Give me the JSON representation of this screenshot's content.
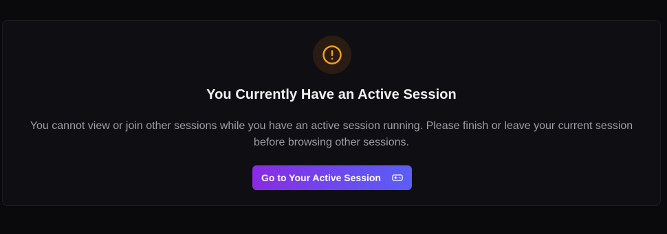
{
  "notice": {
    "title": "You Currently Have an Active Session",
    "message": "You cannot view or join other sessions while you have an active session running. Please finish or leave your current session before browsing other sessions.",
    "button_label": "Go to Your Active Session",
    "icons": {
      "alert": "alert-circle-icon",
      "button": "gamepad-icon"
    },
    "colors": {
      "background": "#0a0a0d",
      "card": "#0f0f13",
      "warning": "#f0a020",
      "button_start": "#8a2be2",
      "button_end": "#5b5ef5"
    }
  }
}
